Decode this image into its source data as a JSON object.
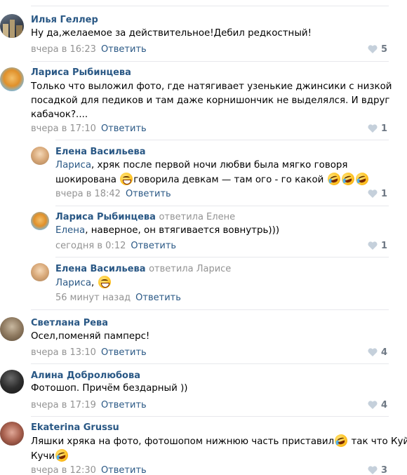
{
  "comments": [
    {
      "author": "Илья Геллер",
      "text": "Ну да,желаемое за действительное!Дебил редкостный!",
      "time": "вчера в 16:23",
      "reply": "Ответить",
      "likes": "5"
    },
    {
      "author": "Лариса Рыбинцева",
      "lines": [
        "Только что выложил фото, где натягивает узенькие джинсики с низкой",
        "посадкой для педиков и там даже корнишончик не выделялся. И вдруг",
        "кабачок?...."
      ],
      "time": "вчера в 17:10",
      "reply": "Ответить",
      "likes": "1"
    },
    {
      "author": "Елена Васильева",
      "mention": "Лариса",
      "line1": ", хряк после первой ночи любви была мягко говоря",
      "line2a": "шокирована ",
      "line2b": "говорила девкам — там ого - го какой ",
      "time": "вчера в 18:42",
      "reply": "Ответить",
      "likes": "1"
    },
    {
      "author": "Лариса Рыбинцева",
      "reply_to": "ответила Елене",
      "mention": "Елена",
      "text": ", наверное, он втягивается вовнутрь)))",
      "time": "сегодня в 0:12",
      "reply": "Ответить",
      "likes": "1"
    },
    {
      "author": "Елена Васильева",
      "reply_to": "ответила Ларисе",
      "mention": "Лариса",
      "text": ", ",
      "time": "56 минут назад",
      "reply": "Ответить"
    },
    {
      "author": "Светлана Рева",
      "text": "Осел,поменяй памперс!",
      "time": "вчера в 13:10",
      "reply": "Ответить",
      "likes": "4"
    },
    {
      "author": "Алина Добролюбова",
      "text": "Фотошоп. Причём бездарный ))",
      "time": "вчера в 17:19",
      "reply": "Ответить",
      "likes": "4"
    },
    {
      "author": "Ekaterina Grussu",
      "line1": "Ляшки хряка на фото, фотошопом нижнюю часть приставил",
      "line1b": " так что Куй",
      "line2": "Кучи",
      "time": "вчера в 12:30",
      "reply": "Ответить",
      "likes": "3"
    }
  ],
  "icons": {
    "like": "heart-icon",
    "emoji_grin": "grinning-face-emoji",
    "emoji_tears": "rolling-laughing-emoji"
  },
  "colors": {
    "author": "#2a5885",
    "meta": "#939393",
    "separator": "#e7e8ec",
    "like": "#6f7985"
  }
}
